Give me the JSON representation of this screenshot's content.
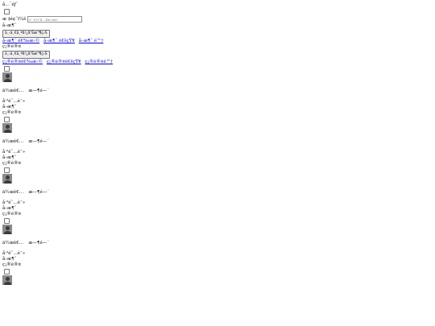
{
  "header": {
    "title": "å…¨éƒ¨"
  },
  "search": {
    "label": "æ ‡é¢˜ï¼š",
    "placeholder": "è¯·è¾“å…¥æ ‡é¢˜"
  },
  "section1": {
    "label": "å–æ¶ˆ",
    "button": "ä¸‹ä¸€ä¸ªå¹¿å‘Šæ”¶ç›Š",
    "links": [
      "å–æ¶ˆ é€‰æ‹©",
      "å–æ¶ˆ é€šçŸ¥",
      "å–æ¶ˆ é™†"
    ]
  },
  "section2": {
    "label": "ç¡®è®¤",
    "button": "ä¸‹ä¸€ä¸ªå¹¿å‘Šæ”¶ç›Š",
    "links": [
      "ç¡®è®¤é€‰æ‹©",
      "ç¡®è®¤é€šçŸ¥",
      "ç¡®è®¤é™†"
    ]
  },
  "cards": [
    {
      "author": "ä½œè€…",
      "date": "æ—¶é—´",
      "status": "å·²é˜…è¯»",
      "cancel": "å–æ¶ˆ",
      "confirm": "ç¡®è®¤"
    },
    {
      "author": "ä½œè€…",
      "date": "æ—¶é—´",
      "status": "å·²é˜…è¯»",
      "cancel": "å–æ¶ˆ",
      "confirm": "ç¡®è®¤"
    },
    {
      "author": "ä½œè€…",
      "date": "æ—¶é—´",
      "status": "å·²é˜…è¯»",
      "cancel": "å–æ¶ˆ",
      "confirm": "ç¡®è®¤"
    },
    {
      "author": "ä½œè€…",
      "date": "æ—¶é—´",
      "status": "å·²é˜…è¯»",
      "cancel": "å–æ¶ˆ",
      "confirm": "ç¡®è®¤"
    }
  ]
}
